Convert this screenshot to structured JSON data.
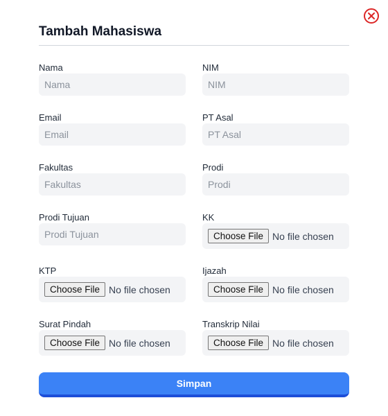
{
  "modal": {
    "title": "Tambah Mahasiswa",
    "close_icon": "close-circle-icon",
    "submit_label": "Simpan"
  },
  "fields": {
    "nama": {
      "label": "Nama",
      "placeholder": "Nama",
      "value": ""
    },
    "nim": {
      "label": "NIM",
      "placeholder": "NIM",
      "value": ""
    },
    "email": {
      "label": "Email",
      "placeholder": "Email",
      "value": ""
    },
    "pt_asal": {
      "label": "PT Asal",
      "placeholder": "PT Asal",
      "value": ""
    },
    "fakultas": {
      "label": "Fakultas",
      "placeholder": "Fakultas",
      "value": ""
    },
    "prodi": {
      "label": "Prodi",
      "placeholder": "Prodi",
      "value": ""
    },
    "prodi_tujuan": {
      "label": "Prodi Tujuan",
      "placeholder": "Prodi Tujuan",
      "value": ""
    },
    "kk": {
      "label": "KK",
      "button": "Choose File",
      "status": "No file chosen"
    },
    "ktp": {
      "label": "KTP",
      "button": "Choose File",
      "status": "No file chosen"
    },
    "ijazah": {
      "label": "Ijazah",
      "button": "Choose File",
      "status": "No file chosen"
    },
    "surat_pindah": {
      "label": "Surat Pindah",
      "button": "Choose File",
      "status": "No file chosen"
    },
    "transkrip_nilai": {
      "label": "Transkrip Nilai",
      "button": "Choose File",
      "status": "No file chosen"
    }
  },
  "colors": {
    "primary": "#3b82f6",
    "primary_dark": "#1d4ed8",
    "danger": "#dc2626",
    "input_bg": "#f3f4f6"
  }
}
